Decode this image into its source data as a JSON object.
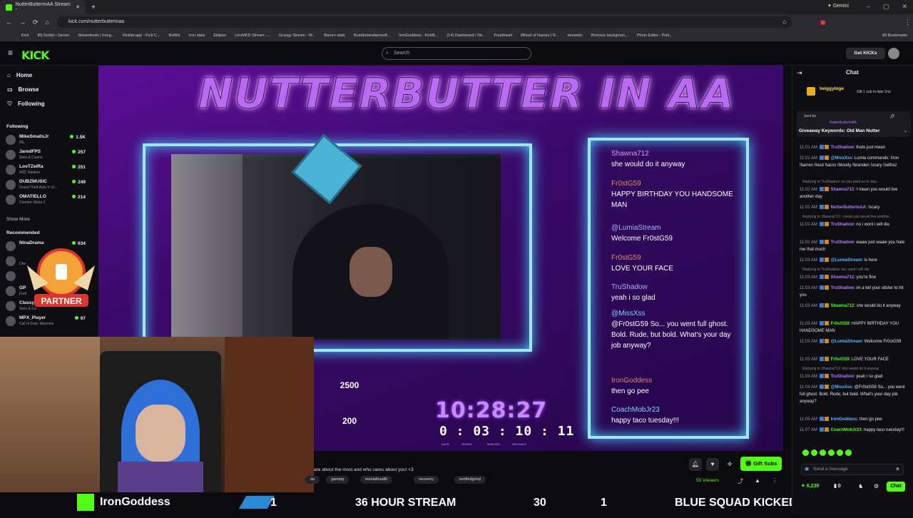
{
  "browser": {
    "tab_title": "NutterButterInAA Stream - ",
    "gemini_label": "Gemini",
    "url": "kick.com/nutterbutterinaa",
    "bookmarks": [
      "Kick",
      "IRLToolkit • Server",
      "Streamloots | Irong...",
      "Kicklet.app - Kick C...",
      "BotRix",
      "Iron stats",
      "Eklipse",
      "LinxMKD Stream -...",
      "Grungy Stream - W...",
      "Barren stats",
      "Bumblebeefarmer8...",
      "IronGoddess - KickB...",
      "(14) Dashboard / Str...",
      "Fourthwall",
      "Wheel of Names | R...",
      "streamin",
      "Remove backgroun...",
      "Photo Editor : Pixlr..."
    ],
    "all_bookmarks": "All Bookmarks"
  },
  "header": {
    "logo": "KICK",
    "search_placeholder": "Search",
    "get_kicks": "Get KICKs"
  },
  "nav": {
    "home": "Home",
    "browse": "Browse",
    "following_link": "Following",
    "following_title": "Following",
    "following": [
      {
        "name": "MikeSmallsJr",
        "category": "IRL",
        "viewers": "1.5K"
      },
      {
        "name": "JaredFPS",
        "category": "Slots & Casino",
        "viewers": "257"
      },
      {
        "name": "LooTZeiRa",
        "category": "ARC Raiders",
        "viewers": "251"
      },
      {
        "name": "DUBZMUSIC",
        "category": "Grand Theft Auto V (G...",
        "viewers": "249"
      },
      {
        "name": "OMATIELLO",
        "category": "Counter-Strike 2",
        "viewers": "214"
      }
    ],
    "show_more": "Show More",
    "recommended_title": "Recommended",
    "recommended": [
      {
        "name": "NinaDrama",
        "category": "",
        "viewers": "634"
      },
      {
        "name": "",
        "category": "Che",
        "viewers": ""
      },
      {
        "name": "",
        "category": "",
        "viewers": ""
      },
      {
        "name": "GP",
        "category": "Forti",
        "viewers": ""
      },
      {
        "name": "Classy",
        "category": "Slots & Ca",
        "viewers": ""
      },
      {
        "name": "MPX_Player",
        "category": "Call of Duty: Warzone",
        "viewers": "97"
      }
    ]
  },
  "stream": {
    "title": "NUTTERBUTTER IN AA",
    "overlay_chat": [
      {
        "user": "Shawna712",
        "text": "she would do it anyway"
      },
      {
        "user": "Fr0stG59",
        "text": "HAPPY BIRTHDAY YOU HANDSOME MAN"
      },
      {
        "user": "@LumiaStream",
        "text": "Welcome Fr0stG59"
      },
      {
        "user": "Fr0stG59",
        "text": "LOVE YOUR FACE"
      },
      {
        "user": "TruShadow",
        "text": "yeah i so glad"
      },
      {
        "user": "@MissXss",
        "text": "@Fr0stG59 So... you went full ghost. Bold. Rude, but bold. What's your day job anyway?"
      },
      {
        "user": "IronGoddess",
        "text": "then go pee"
      },
      {
        "user": "CoachMobJr23",
        "text": "happy taco tuesday!!!"
      }
    ],
    "goal1": "2500",
    "goal2": "200",
    "clock": "10:28:27",
    "countdown": "0 : 03 : 10 : 11",
    "countdown_labels": [
      "DAYS",
      "HOURS",
      "MINUTES",
      "SECONDS"
    ],
    "partner": "PARTNER",
    "cam2_name": "IronGoddess",
    "ticker_1": "1",
    "ticker_hour": "36 HOUR STREAM",
    "ticker_30": "30",
    "ticker_1b": "1",
    "ticker_squad": "BLUE SQUAD KICKED",
    "ticker_2500": "2500"
  },
  "info": {
    "description": "are about the most and who cares about you! <3",
    "tags": [
      "da",
      "gaming",
      "mentalhealth",
      "recovery",
      "verifiedgrind"
    ],
    "viewers": "55 Viewers",
    "gift_subs": "Gift Subs"
  },
  "chat": {
    "title": "Chat",
    "pinned_user": "twiggybige",
    "pinned_text": "Gift 1 sub to take 2nd",
    "sent_by": "Sent by",
    "sent_by_user": "NutterButterInAA",
    "giveaway": "Giveaway Keywords: Old Man Nutter",
    "placeholder": "Send a message",
    "kicks_count": "6,239",
    "count2": "0",
    "chat_btn": "Chat",
    "accent": "#53fc18",
    "messages": [
      {
        "reply": "",
        "time": "11:01 AM",
        "user": "TruShadow",
        "color": "#b07cff",
        "text": "thats just mean"
      },
      {
        "reply": "",
        "time": "11:01 AM",
        "user": "@MissXss",
        "color": "#5ab8ff",
        "text": "Lumia commands: !iron !barren !loud !tacos !bloody !branden !scary !selfrez"
      },
      {
        "reply": "Replying to TruShadow: so you want us to stay...",
        "time": "11:02 AM",
        "user": "Shawna712",
        "color": "#b07cff",
        "text": "I mean you would live another day"
      },
      {
        "reply": "",
        "time": "11:02 AM",
        "user": "NutterButterInAA",
        "color": "#b07cff",
        "text": "!scary"
      },
      {
        "reply": "Replying to Shawna712: i mean you would live another...",
        "time": "11:02 AM",
        "user": "TruShadow",
        "color": "#b07cff",
        "text": "no i wont i will die"
      },
      {
        "reply": "",
        "time": "11:02 AM",
        "user": "TruShadow",
        "color": "#b07cff",
        "text": "waaw just waaw you hate me that much"
      },
      {
        "reply": "",
        "time": "11:03 AM",
        "user": "@LumiaStream",
        "color": "#5ab8ff",
        "text": "is here"
      },
      {
        "reply": "Replying to TruShadow: no i wont i will die",
        "time": "11:03 AM",
        "user": "Shawna712",
        "color": "#b07cff",
        "text": "you're fine"
      },
      {
        "reply": "",
        "time": "11:03 AM",
        "user": "TruShadow",
        "color": "#b07cff",
        "text": "im a tell your sitster to hit you"
      },
      {
        "reply": "",
        "time": "11:03 AM",
        "user": "Shawna712",
        "color": "#53fc18",
        "text": "she would do it anyway"
      },
      {
        "reply": "",
        "time": "11:03 AM",
        "user": "Fr0stG59",
        "color": "#53fc18",
        "text": "HAPPY BIRTHDAY YOU HANDSOME MAN"
      },
      {
        "reply": "",
        "time": "11:03 AM",
        "user": "@LumiaStream",
        "color": "#5ab8ff",
        "text": "Welcome Fr0stG59"
      },
      {
        "reply": "",
        "time": "11:03 AM",
        "user": "Fr0stG59",
        "color": "#53fc18",
        "text": "LOVE YOUR FACE"
      },
      {
        "reply": "Replying to Shawna712: she would do it anyway",
        "time": "11:04 AM",
        "user": "TruShadow",
        "color": "#b07cff",
        "text": "yeah i so glad"
      },
      {
        "reply": "",
        "time": "11:04 AM",
        "user": "@MissXss",
        "color": "#5ab8ff",
        "text": "@Fr0stG59 So... you went full ghost. Bold. Rude, but bold. What's your day job anyway?"
      },
      {
        "reply": "",
        "time": "11:05 AM",
        "user": "IronGoddess",
        "color": "#5ab8ff",
        "text": "then go pee"
      },
      {
        "reply": "",
        "time": "11:07 AM",
        "user": "CoachMobJr23",
        "color": "#53fc18",
        "text": "happy taco tuesday!!!"
      }
    ]
  }
}
